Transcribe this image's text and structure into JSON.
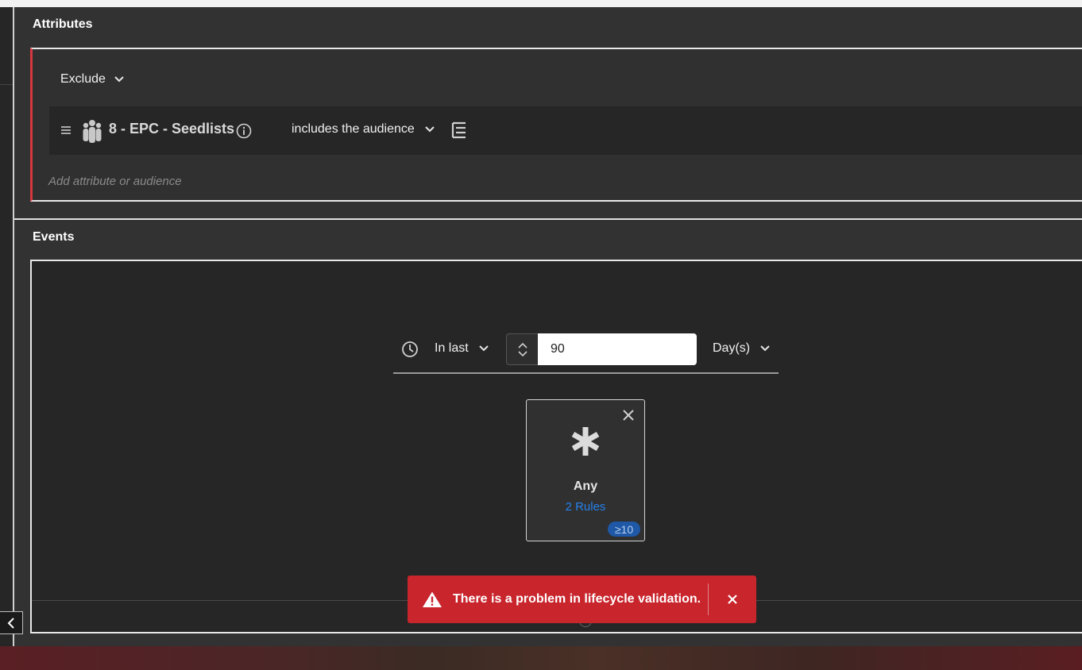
{
  "attributes": {
    "title": "Attributes",
    "exclude_label": "Exclude",
    "audience_name": "8 - EPC - Seedlists",
    "condition_label": "includes the audience",
    "add_placeholder": "Add attribute or audience"
  },
  "events": {
    "title": "Events",
    "time_operator": "In last",
    "time_value": "90",
    "time_unit": "Day(s)",
    "card": {
      "label": "Any",
      "rules_link": "2 Rules",
      "badge": "≥10",
      "icon": "asterisk-icon"
    }
  },
  "toast": {
    "message": "There is a problem in lifecycle validation.",
    "icon": "alert-triangle-icon",
    "color": "#c9252d"
  },
  "colors": {
    "accent_link": "#2680eb",
    "exclude_border": "#d7373f",
    "badge_bg": "#1e58a6"
  }
}
